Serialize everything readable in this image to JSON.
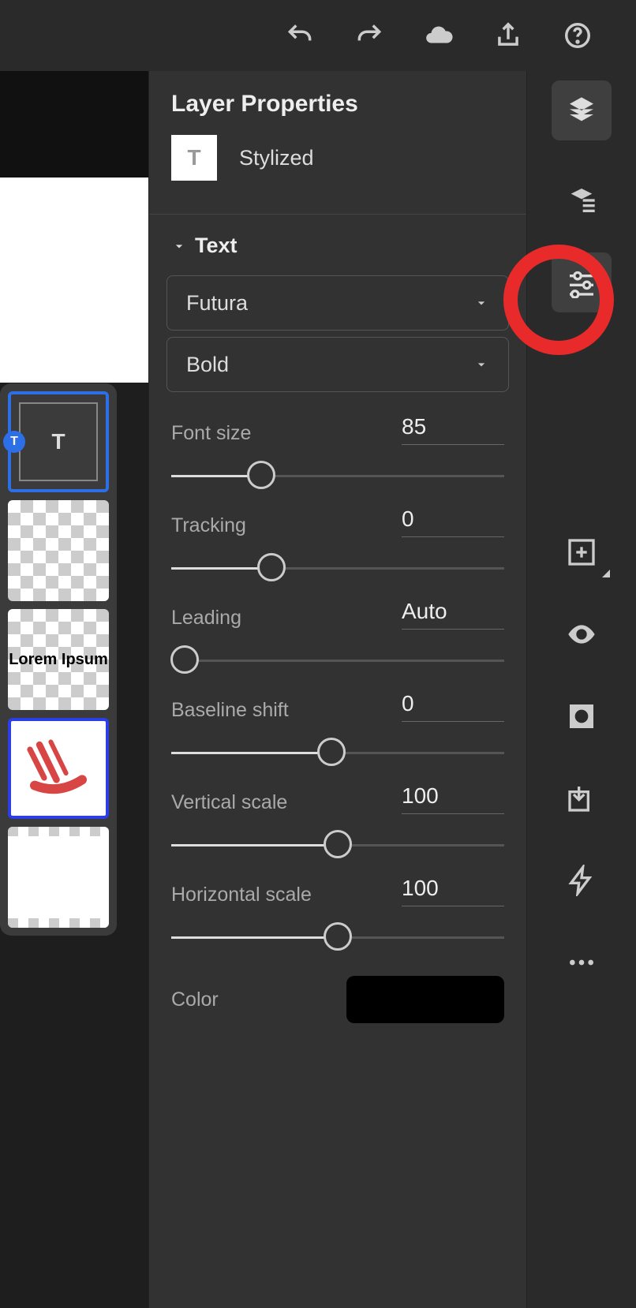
{
  "topbar": {
    "undo": "undo",
    "redo": "redo",
    "cloud": "cloud",
    "share": "share",
    "help": "help"
  },
  "layers_strip": {
    "selected_badge": "T",
    "selected_letter": "T",
    "lorem_text": "Lorem Ipsum"
  },
  "panel": {
    "title": "Layer Properties",
    "layer_icon": "T",
    "layer_name": "Stylized",
    "section": "Text",
    "font_family": "Futura",
    "font_weight": "Bold",
    "sliders": [
      {
        "label": "Font size",
        "value": "85",
        "fill": 27,
        "handle": 27
      },
      {
        "label": "Tracking",
        "value": "0",
        "fill": 30,
        "handle": 30
      },
      {
        "label": "Leading",
        "value": "Auto",
        "fill": 0,
        "handle": 4
      },
      {
        "label": "Baseline shift",
        "value": "0",
        "fill": 48,
        "handle": 48
      },
      {
        "label": "Vertical scale",
        "value": "100",
        "fill": 50,
        "handle": 50
      },
      {
        "label": "Horizontal scale",
        "value": "100",
        "fill": 50,
        "handle": 50
      }
    ],
    "color_label": "Color",
    "color_value": "#000000"
  }
}
